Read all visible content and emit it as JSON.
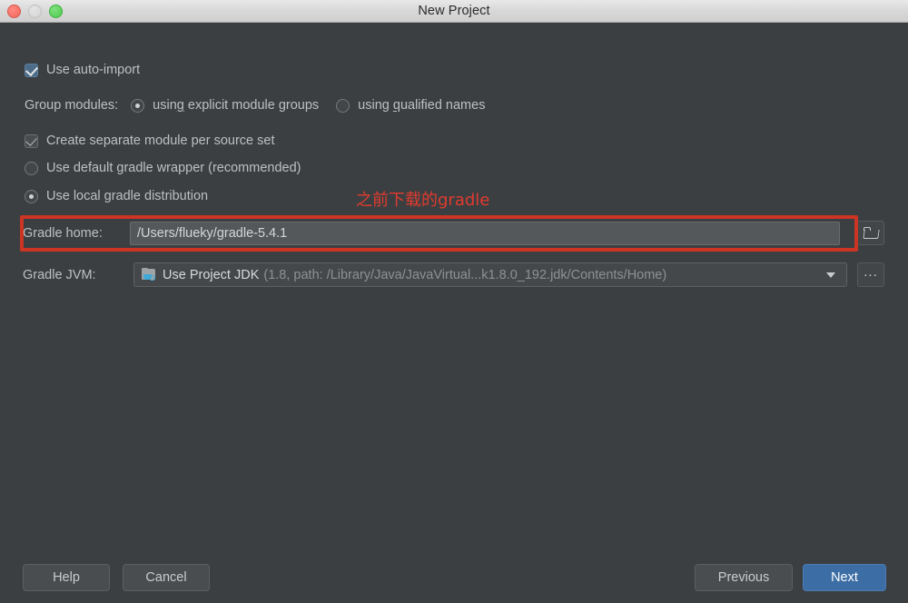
{
  "window": {
    "title": "New Project",
    "traffic_lights": [
      "close-button",
      "minimize-button",
      "zoom-button"
    ]
  },
  "form": {
    "auto_import": {
      "label": "Use auto-import",
      "checked": true
    },
    "group_modules": {
      "label": "Group modules:",
      "options": [
        {
          "label": "using explicit module groups",
          "mnemonic": "g",
          "selected": true
        },
        {
          "label": "using qualified names",
          "mnemonic": "q",
          "selected": false
        }
      ]
    },
    "separate_module": {
      "label": "Create separate module per source set",
      "checked": true
    },
    "gradle_source": {
      "options": [
        {
          "label": "Use default gradle wrapper (recommended)",
          "selected": false
        },
        {
          "label": "Use local gradle distribution",
          "selected": true
        }
      ]
    },
    "gradle_home": {
      "label": "Gradle home:",
      "value": "/Users/flueky/gradle-5.4.1",
      "browse_icon": "folder-icon"
    },
    "gradle_jvm": {
      "label": "Gradle JVM:",
      "icon": "jdk-folder-icon",
      "value": "Use Project JDK",
      "detail": "(1.8, path: /Library/Java/JavaVirtual...k1.8.0_192.jdk/Contents/Home)",
      "more_label": "..."
    }
  },
  "annotation": {
    "text": "之前下载的gradle",
    "color": "#e03b2f",
    "highlight_color": "#cc3424"
  },
  "footer": {
    "help": "Help",
    "cancel": "Cancel",
    "previous": "Previous",
    "next": "Next",
    "next_accent": "#3c6ea5"
  }
}
